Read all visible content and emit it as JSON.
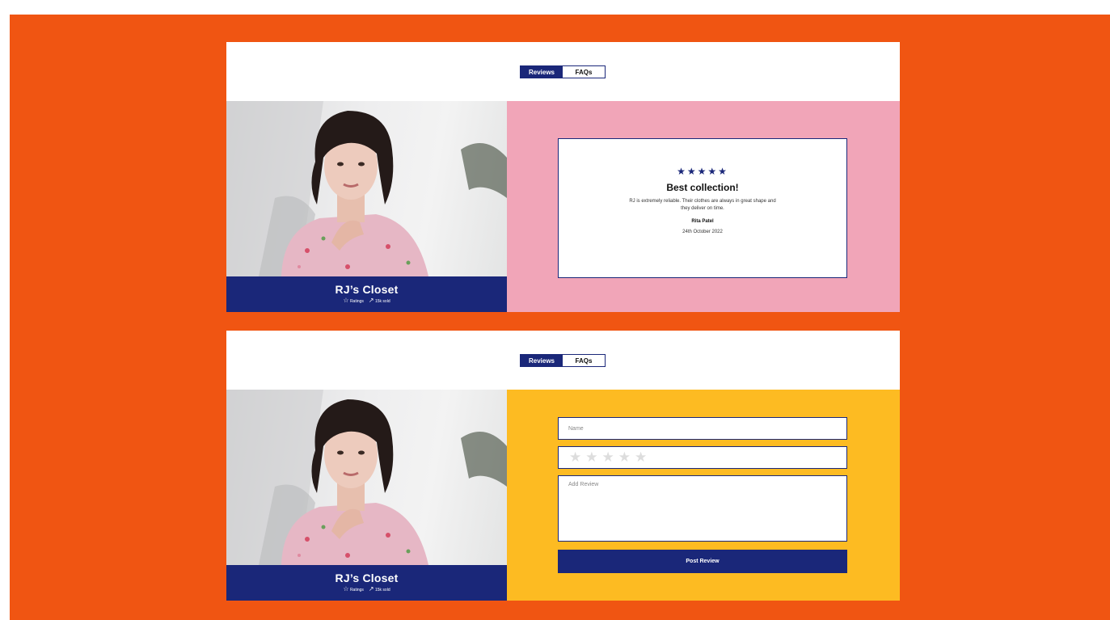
{
  "tabs": {
    "reviews": "Reviews",
    "faqs": "FAQs"
  },
  "shop": {
    "name": "RJ’s Closet",
    "ratings_label": "Ratings",
    "sold_label": "15k sold",
    "star_icon": "☆",
    "trend_icon": "↗"
  },
  "review": {
    "stars": "★★★★★",
    "title": "Best collection!",
    "text": "RJ is extremely reliable. Their clothes are always in great shape and they deliver on time.",
    "reviewer": "Rita Patel",
    "date": "24th October 2022"
  },
  "form": {
    "name_placeholder": "Name",
    "rating_stars": "★★★★★",
    "review_placeholder": "Add Review",
    "post_label": "Post Review"
  },
  "colors": {
    "background": "#f05512",
    "navy": "#1a2779",
    "pink": "#f1a5b8",
    "yellow": "#fdbb22"
  }
}
